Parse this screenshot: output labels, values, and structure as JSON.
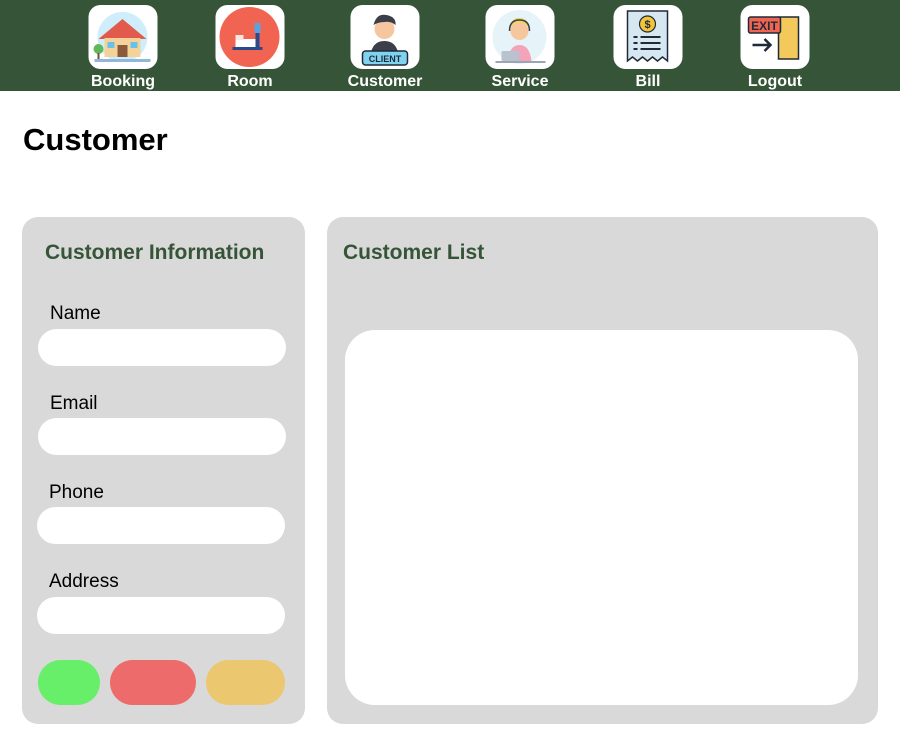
{
  "nav": {
    "items": [
      {
        "label": "Booking",
        "icon": "house-icon"
      },
      {
        "label": "Room",
        "icon": "bed-icon"
      },
      {
        "label": "Customer",
        "icon": "client-icon"
      },
      {
        "label": "Service",
        "icon": "support-agent-icon"
      },
      {
        "label": "Bill",
        "icon": "receipt-icon"
      },
      {
        "label": "Logout",
        "icon": "exit-door-icon"
      }
    ]
  },
  "page": {
    "title": "Customer"
  },
  "form": {
    "title": "Customer Information",
    "fields": [
      {
        "label": "Name",
        "value": ""
      },
      {
        "label": "Email",
        "value": ""
      },
      {
        "label": "Phone",
        "value": ""
      },
      {
        "label": "Address",
        "value": ""
      }
    ],
    "buttons": [
      {
        "name": "add",
        "color": "#68ef6a"
      },
      {
        "name": "delete",
        "color": "#ed6b6b"
      },
      {
        "name": "update",
        "color": "#ebc76f"
      }
    ]
  },
  "list": {
    "title": "Customer List",
    "rows": []
  },
  "colors": {
    "nav_background": "#365438",
    "panel_background": "#d9d9d9",
    "heading_green": "#365438"
  }
}
